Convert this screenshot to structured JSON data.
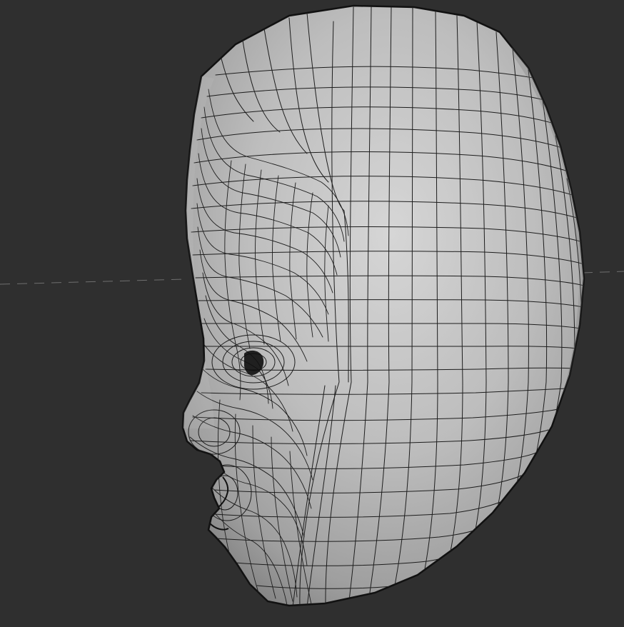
{
  "viewport": {
    "background": "#2f2f2f",
    "grid_line_color": "#6f6f6f",
    "mesh_fill_light": "#d3d3d3",
    "mesh_fill_dark": "#8c8c8c",
    "wire_color": "#1d1d1d",
    "object": "head-wireframe-mesh",
    "shading": "smooth-with-wireframe"
  }
}
